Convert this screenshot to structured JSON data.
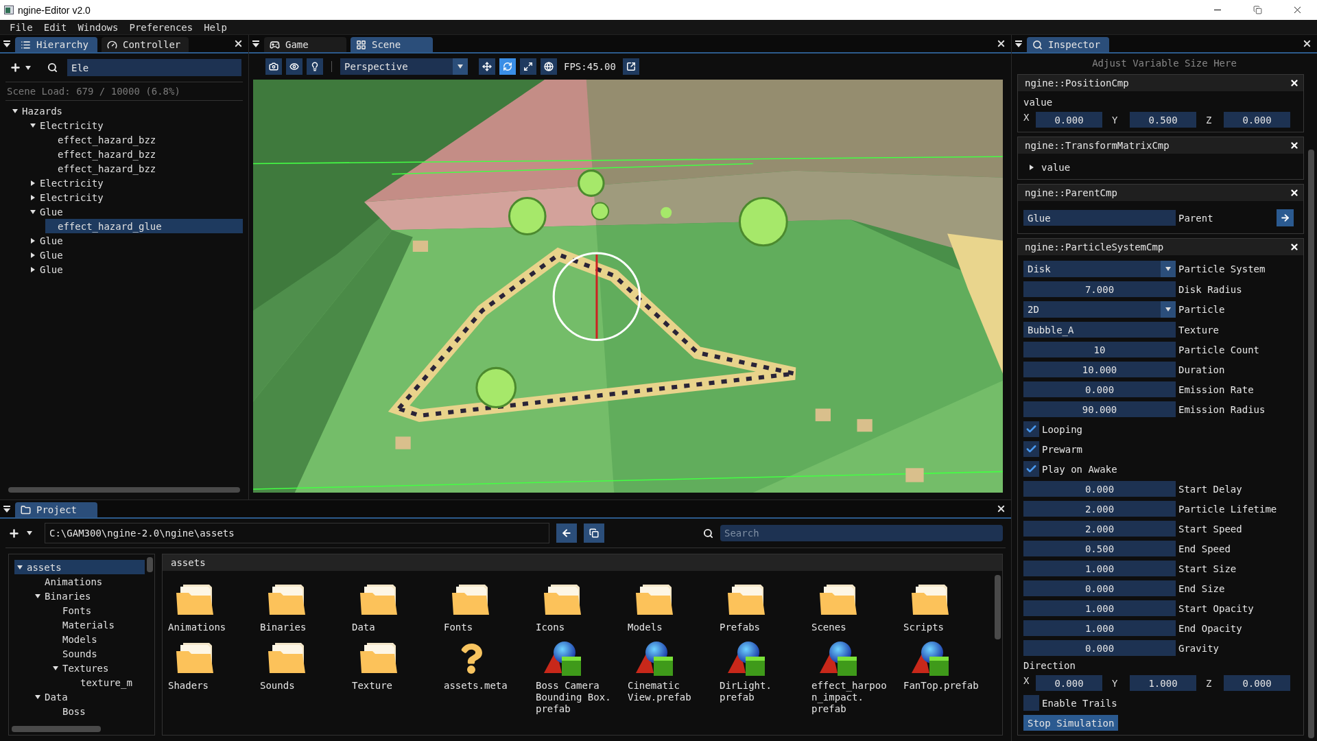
{
  "window": {
    "title": "ngine-Editor v2.0"
  },
  "menu": [
    "File",
    "Edit",
    "Windows",
    "Preferences",
    "Help"
  ],
  "hierarchy_panel": {
    "tabs": [
      {
        "label": "Hierarchy",
        "kind": "list",
        "selected": true
      },
      {
        "label": "Controller",
        "kind": "gauge",
        "selected": false
      }
    ],
    "search": {
      "value": "Ele"
    },
    "scene_load": "Scene Load: 679 / 10000 (6.8%)",
    "tree": [
      {
        "label": "Hazards",
        "expanded": true,
        "selected": false,
        "children": [
          {
            "label": "Electricity",
            "expanded": true,
            "selected": false,
            "children": [
              {
                "label": "effect_hazard_bzz",
                "selected": false
              },
              {
                "label": "effect_hazard_bzz",
                "selected": false
              },
              {
                "label": "effect_hazard_bzz",
                "selected": false
              }
            ]
          },
          {
            "label": "Electricity",
            "expanded": false,
            "selected": false
          },
          {
            "label": "Electricity",
            "expanded": false,
            "selected": false
          },
          {
            "label": "Glue",
            "expanded": true,
            "selected": false,
            "children": [
              {
                "label": "effect_hazard_glue",
                "selected": true
              }
            ]
          },
          {
            "label": "Glue",
            "expanded": false,
            "selected": false
          },
          {
            "label": "Glue",
            "expanded": false,
            "selected": false
          },
          {
            "label": "Glue",
            "expanded": false,
            "selected": false
          }
        ]
      }
    ]
  },
  "viewport": {
    "tabs": [
      {
        "label": "Game",
        "kind": "gamepad",
        "selected": false
      },
      {
        "label": "Scene",
        "kind": "grid",
        "selected": true
      }
    ],
    "view_tools": [
      {
        "kind": "camera",
        "selected": false
      },
      {
        "kind": "eye",
        "selected": false
      },
      {
        "kind": "light",
        "selected": false
      }
    ],
    "camera_mode": "Perspective",
    "gizmo_tools": [
      {
        "kind": "move",
        "selected": false
      },
      {
        "kind": "rotate",
        "selected": true
      },
      {
        "kind": "scale",
        "selected": false
      },
      {
        "kind": "world",
        "selected": false
      }
    ],
    "fps": "FPS:45.00"
  },
  "project_panel": {
    "tab": "Project",
    "path": "C:\\GAM300\\ngine-2.0\\ngine\\assets",
    "search": {
      "placeholder": "Search"
    },
    "folder_tree": [
      {
        "label": "assets",
        "expanded": true,
        "selected": true,
        "children": [
          {
            "label": "Animations",
            "selected": false
          },
          {
            "label": "Binaries",
            "expanded": true,
            "selected": false,
            "children": [
              {
                "label": "Fonts",
                "selected": false
              },
              {
                "label": "Materials",
                "selected": false
              },
              {
                "label": "Models",
                "selected": false
              },
              {
                "label": "Sounds",
                "selected": false
              },
              {
                "label": "Textures",
                "expanded": true,
                "selected": false,
                "children": [
                  {
                    "label": "texture_m",
                    "selected": false
                  }
                ]
              }
            ]
          },
          {
            "label": "Data",
            "expanded": true,
            "selected": false,
            "children": [
              {
                "label": "Boss",
                "selected": false
              }
            ]
          }
        ]
      }
    ],
    "breadcrumb": "assets",
    "items": [
      {
        "kind": "folder",
        "name": "Animations"
      },
      {
        "kind": "folder",
        "name": "Binaries"
      },
      {
        "kind": "folder",
        "name": "Data"
      },
      {
        "kind": "folder",
        "name": "Fonts"
      },
      {
        "kind": "folder",
        "name": "Icons"
      },
      {
        "kind": "folder",
        "name": "Models"
      },
      {
        "kind": "folder",
        "name": "Prefabs"
      },
      {
        "kind": "folder",
        "name": "Scenes"
      },
      {
        "kind": "folder",
        "name": "Scripts"
      },
      {
        "kind": "folder",
        "name": "Shaders"
      },
      {
        "kind": "folder",
        "name": "Sounds"
      },
      {
        "kind": "folder",
        "name": "Texture"
      },
      {
        "kind": "unknown",
        "name": "assets.meta"
      },
      {
        "kind": "prefab",
        "name": "Boss Camera Bounding Box.prefab"
      },
      {
        "kind": "prefab",
        "name": "Cinematic View.prefab"
      },
      {
        "kind": "prefab",
        "name": "DirLight.prefab"
      },
      {
        "kind": "prefab",
        "name": "effect_harpoon_impact.prefab"
      },
      {
        "kind": "prefab",
        "name": "FanTop.prefab"
      }
    ]
  },
  "inspector": {
    "tab": "Inspector",
    "hint": "Adjust Variable Size Here",
    "components": [
      {
        "title": "ngine::PositionCmp",
        "fields": [
          {
            "kind": "vector",
            "label": "value",
            "axes": [
              {
                "axis": "X",
                "value": "0.000"
              },
              {
                "axis": "Y",
                "value": "0.500"
              },
              {
                "axis": "Z",
                "value": "0.000"
              }
            ]
          }
        ]
      },
      {
        "title": "ngine::TransformMatrixCmp",
        "fields": [
          {
            "kind": "tree",
            "label": "value",
            "expanded": false
          }
        ]
      },
      {
        "title": "ngine::ParentCmp",
        "fields": [
          {
            "kind": "link",
            "value": "Glue",
            "label": "Parent"
          }
        ]
      },
      {
        "title": "ngine::ParticleSystemCmp",
        "fields": [
          {
            "kind": "combo",
            "value": "Disk",
            "label": "Particle System"
          },
          {
            "kind": "number",
            "value": "7.000",
            "label": "Disk Radius"
          },
          {
            "kind": "combo",
            "value": "2D",
            "label": "Particle"
          },
          {
            "kind": "text",
            "value": "Bubble_A",
            "label": "Texture"
          },
          {
            "kind": "number",
            "value": "10",
            "label": "Particle Count"
          },
          {
            "kind": "number",
            "value": "10.000",
            "label": "Duration"
          },
          {
            "kind": "number",
            "value": "0.000",
            "label": "Emission Rate"
          },
          {
            "kind": "number",
            "value": "90.000",
            "label": "Emission Radius"
          },
          {
            "kind": "checkbox",
            "caption": "Looping",
            "checked": true
          },
          {
            "kind": "checkbox",
            "caption": "Prewarm",
            "checked": true
          },
          {
            "kind": "checkbox",
            "caption": "Play on Awake",
            "checked": true
          },
          {
            "kind": "number",
            "value": "0.000",
            "label": "Start Delay"
          },
          {
            "kind": "number",
            "value": "2.000",
            "label": "Particle Lifetime"
          },
          {
            "kind": "number",
            "value": "2.000",
            "label": "Start Speed"
          },
          {
            "kind": "number",
            "value": "0.500",
            "label": "End Speed"
          },
          {
            "kind": "number",
            "value": "1.000",
            "label": "Start Size"
          },
          {
            "kind": "number",
            "value": "0.000",
            "label": "End Size"
          },
          {
            "kind": "number",
            "value": "1.000",
            "label": "Start Opacity"
          },
          {
            "kind": "number",
            "value": "1.000",
            "label": "End Opacity"
          },
          {
            "kind": "number",
            "value": "0.000",
            "label": "Gravity"
          },
          {
            "kind": "vector",
            "label": "Direction",
            "axes": [
              {
                "axis": "X",
                "value": "0.000"
              },
              {
                "axis": "Y",
                "value": "1.000"
              },
              {
                "axis": "Z",
                "value": "0.000"
              }
            ]
          },
          {
            "kind": "checkbox",
            "caption": "Enable Trails",
            "checked": false
          },
          {
            "kind": "button",
            "label": "Stop Simulation"
          }
        ]
      }
    ]
  }
}
